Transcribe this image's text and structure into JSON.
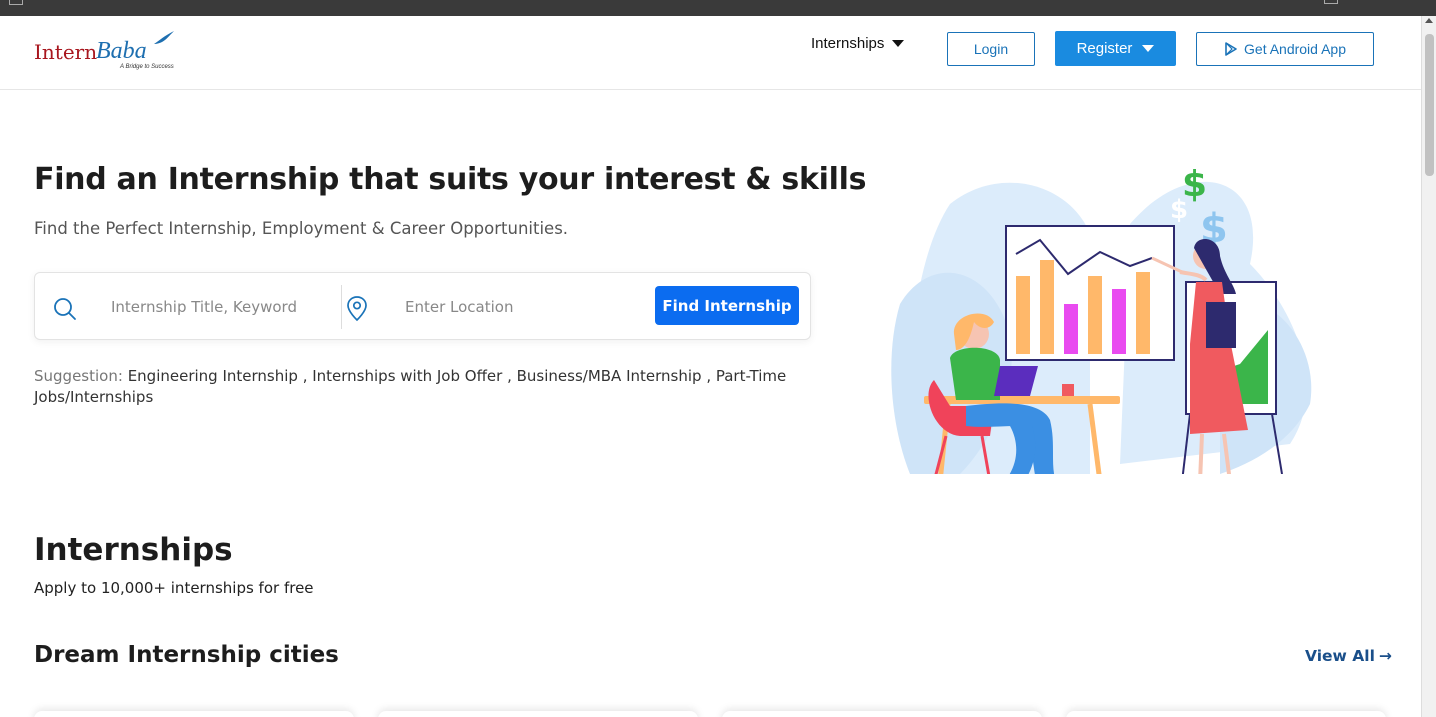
{
  "header": {
    "logo_intern": "Intern",
    "logo_baba": "Baba",
    "logo_tagline": "A Bridge to Success",
    "nav_internships": "Internships",
    "login": "Login",
    "register": "Register",
    "android": "Get Android App"
  },
  "hero": {
    "title": "Find an Internship that suits your interest & skills",
    "subtitle": "Find the Perfect Internship, Employment & Career Opportunities.",
    "search_placeholder": "Internship Title, Keyword",
    "location_placeholder": "Enter Location",
    "find_button": "Find Internship",
    "suggestion_label": "Suggestion:",
    "suggestions": [
      "Engineering Internship",
      "Internships with Job Offer",
      "Business/MBA Internship",
      "Part-Time Jobs/Internships"
    ]
  },
  "section": {
    "title": "Internships",
    "subtitle": "Apply to 10,000+ internships for free",
    "cities_title": "Dream Internship cities",
    "view_all": "View All",
    "view_all_arrow": "→"
  },
  "colors": {
    "brand_red": "#a8161e",
    "brand_blue": "#1a73b8",
    "register_bg": "#1a8be0",
    "find_bg": "#0b6cf0"
  },
  "icons": {
    "search": "search-icon",
    "location": "location-pin-icon",
    "caret": "caret-down-icon",
    "play": "play-store-icon",
    "arrow": "arrow-right-icon"
  }
}
